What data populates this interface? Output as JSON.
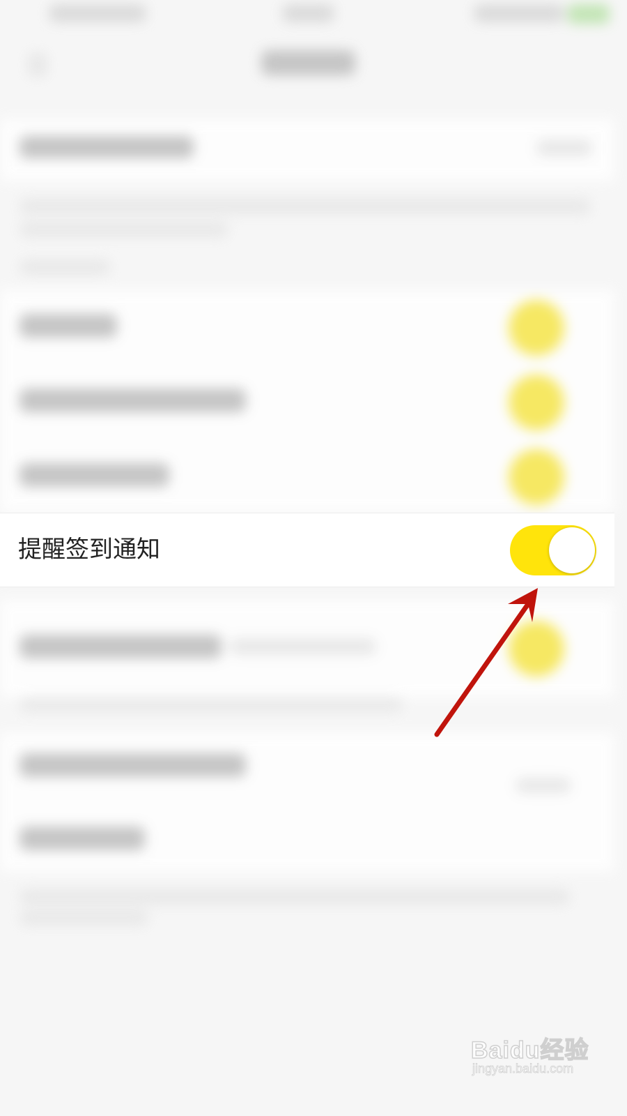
{
  "setting_row": {
    "label": "提醒签到通知",
    "toggle_on": true
  },
  "colors": {
    "toggle_track": "#ffe40b",
    "toggle_knob": "#ffffff",
    "arrow": "#c0140c",
    "page_bg": "#f6f6f6"
  },
  "watermark": {
    "main": "Baidu经验",
    "sub": "jingyan.baidu.com"
  },
  "icons": {
    "back": "back-arrow-icon",
    "annotation": "red-arrow-icon",
    "watermark": "baidu-paw-icon"
  }
}
